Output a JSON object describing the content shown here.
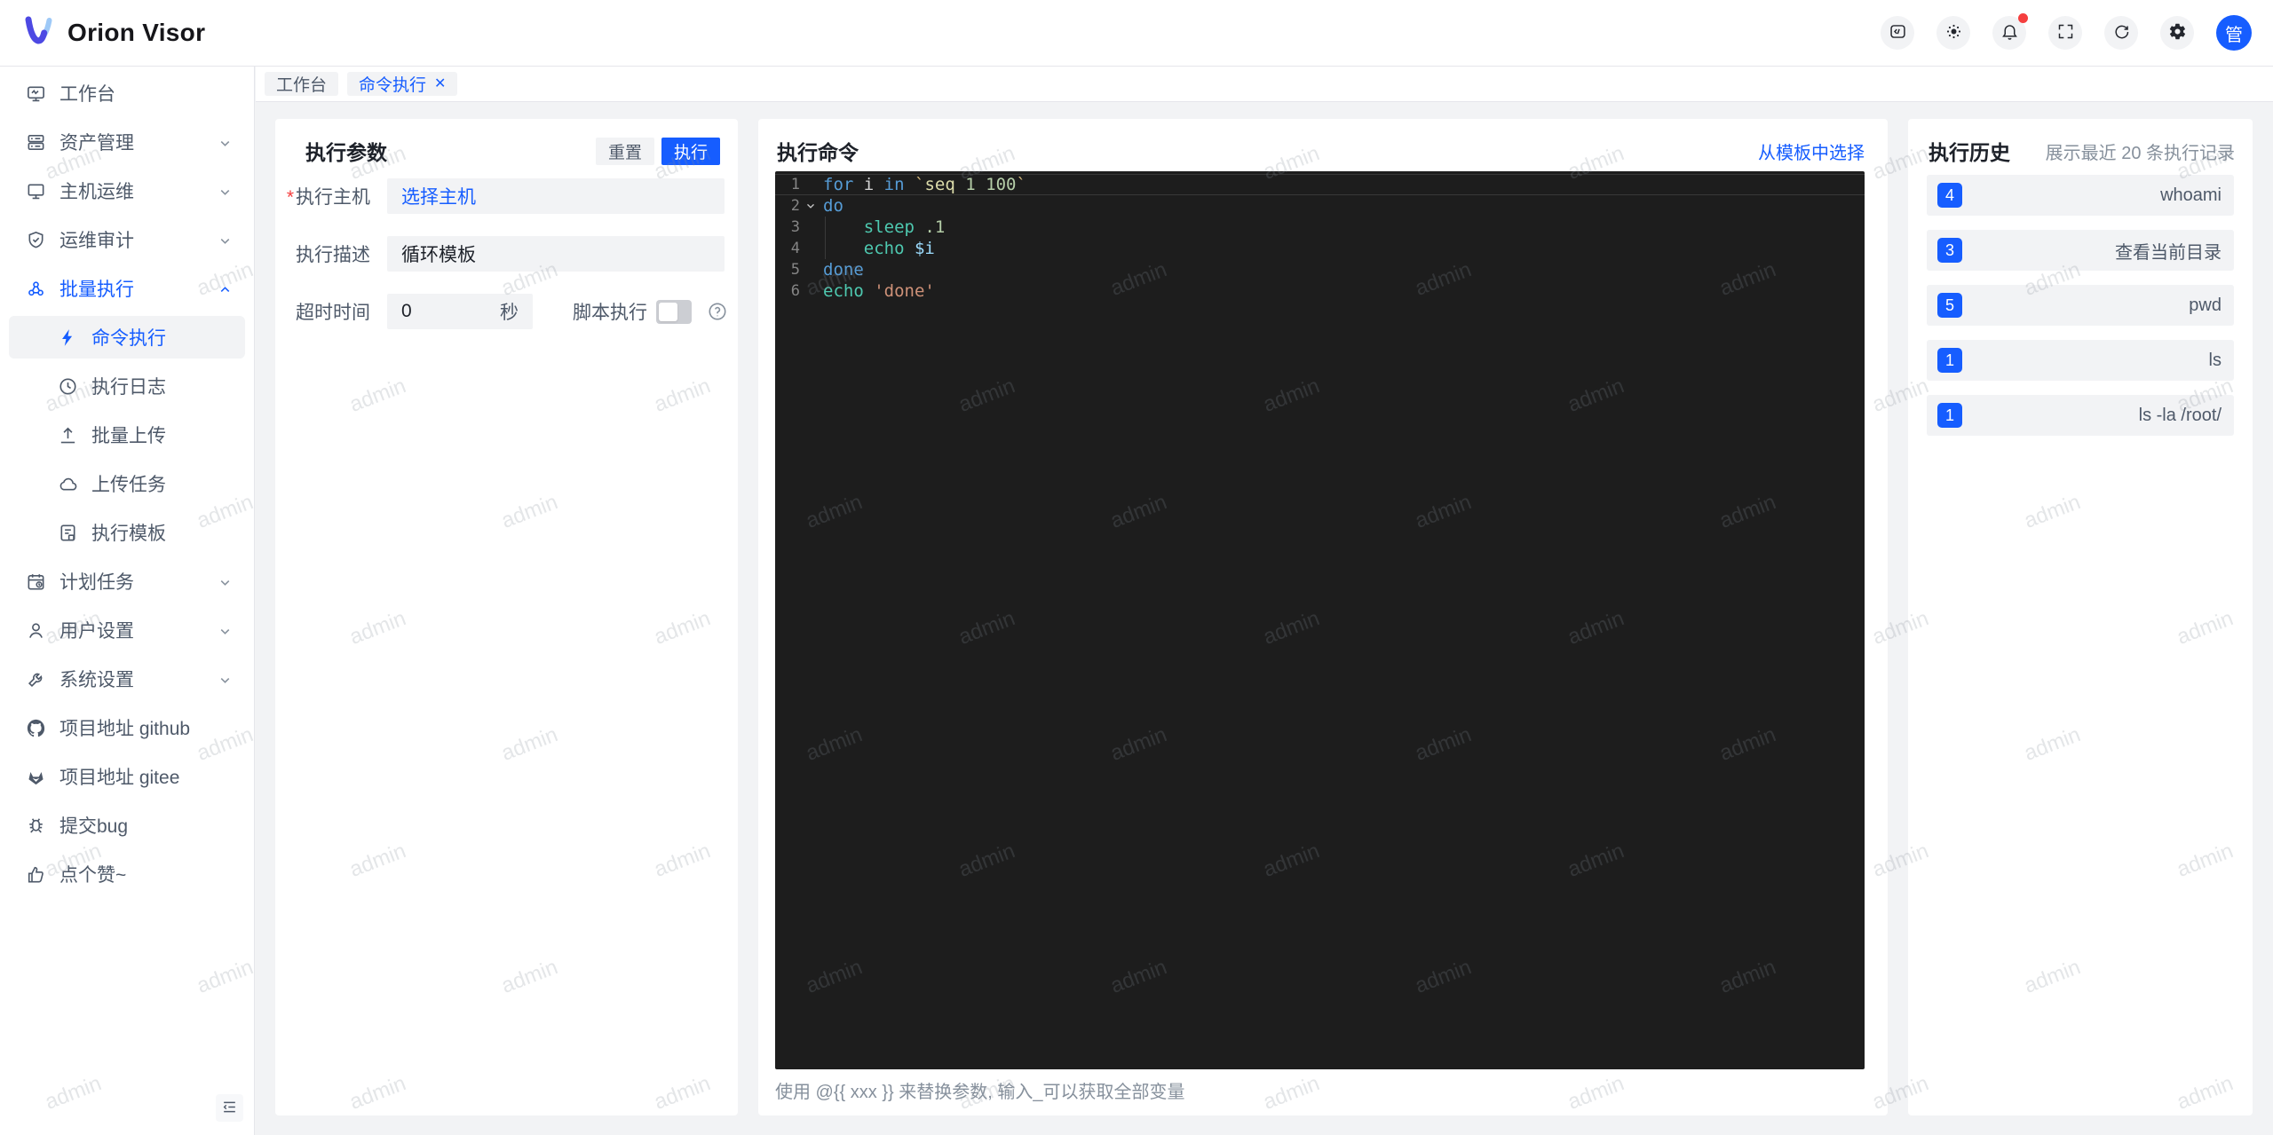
{
  "app": {
    "title": "Orion Visor"
  },
  "header": {
    "icons": [
      "code-settings-icon",
      "theme-icon",
      "notifications-icon",
      "fullscreen-icon",
      "refresh-icon",
      "gear-icon"
    ],
    "notification_badge": true,
    "avatar_text": "管"
  },
  "tabs": [
    {
      "id": "workbench",
      "label": "工作台",
      "active": false,
      "closable": false
    },
    {
      "id": "command-execution",
      "label": "命令执行",
      "active": true,
      "closable": true
    }
  ],
  "sidebar": {
    "items": [
      {
        "id": "workbench",
        "label": "工作台",
        "icon": "workbench-icon"
      },
      {
        "id": "asset-management",
        "label": "资产管理",
        "icon": "asset-icon",
        "chevron": "down"
      },
      {
        "id": "host-ops",
        "label": "主机运维",
        "icon": "host-icon",
        "chevron": "down"
      },
      {
        "id": "ops-audit",
        "label": "运维审计",
        "icon": "audit-icon",
        "chevron": "down"
      },
      {
        "id": "batch-execution",
        "label": "批量执行",
        "icon": "batch-icon",
        "chevron": "up",
        "active": true
      },
      {
        "id": "command-execution",
        "label": "命令执行",
        "icon": "lightning-icon",
        "child": true,
        "selected": true
      },
      {
        "id": "execution-log",
        "label": "执行日志",
        "icon": "history-icon",
        "child": true
      },
      {
        "id": "batch-upload",
        "label": "批量上传",
        "icon": "upload-icon",
        "child": true
      },
      {
        "id": "upload-tasks",
        "label": "上传任务",
        "icon": "cloud-icon",
        "child": true
      },
      {
        "id": "execution-template",
        "label": "执行模板",
        "icon": "template-icon",
        "child": true
      },
      {
        "id": "scheduled-tasks",
        "label": "计划任务",
        "icon": "schedule-icon",
        "chevron": "down"
      },
      {
        "id": "user-settings",
        "label": "用户设置",
        "icon": "user-icon",
        "chevron": "down"
      },
      {
        "id": "system-settings",
        "label": "系统设置",
        "icon": "wrench-icon",
        "chevron": "down"
      },
      {
        "id": "github",
        "label": "项目地址 github",
        "icon": "github-icon"
      },
      {
        "id": "gitee",
        "label": "项目地址 gitee",
        "icon": "gitee-icon"
      },
      {
        "id": "submit-bug",
        "label": "提交bug",
        "icon": "bug-icon"
      },
      {
        "id": "like",
        "label": "点个赞~",
        "icon": "thumbs-up-icon"
      }
    ]
  },
  "params_panel": {
    "title": "执行参数",
    "reset_label": "重置",
    "run_label": "执行",
    "fields": [
      {
        "label": "执行主机",
        "required": true,
        "value": "选择主机",
        "type": "link"
      },
      {
        "label": "执行描述",
        "required": false,
        "value": "循环模板",
        "type": "input"
      },
      {
        "label": "超时时间",
        "required": false,
        "value": "0",
        "suffix": "秒",
        "type": "input"
      }
    ],
    "script_exec_label": "脚本执行",
    "script_exec_on": false
  },
  "command_panel": {
    "title": "执行命令",
    "template_link": "从模板中选择",
    "hint": "使用 @{{ xxx }} 来替换参数, 输入_可以获取全部变量",
    "code_lines": [
      {
        "n": 1,
        "current": true,
        "tokens": [
          [
            "kw",
            "for"
          ],
          [
            "txt",
            " i "
          ],
          [
            "kw",
            "in"
          ],
          [
            "txt",
            " "
          ],
          [
            "tick",
            "`"
          ],
          [
            "fn",
            "seq"
          ],
          [
            "txt",
            " "
          ],
          [
            "num",
            "1"
          ],
          [
            "txt",
            " "
          ],
          [
            "num",
            "100"
          ],
          [
            "tick",
            "`"
          ]
        ]
      },
      {
        "n": 2,
        "fold": true,
        "tokens": [
          [
            "kw",
            "do"
          ]
        ]
      },
      {
        "n": 3,
        "guide": true,
        "tokens": [
          [
            "txt",
            "    "
          ],
          [
            "cmd",
            "sleep"
          ],
          [
            "txt",
            " "
          ],
          [
            "num",
            ".1"
          ]
        ]
      },
      {
        "n": 4,
        "guide": true,
        "tokens": [
          [
            "txt",
            "    "
          ],
          [
            "cmd",
            "echo"
          ],
          [
            "txt",
            " "
          ],
          [
            "var",
            "$i"
          ]
        ]
      },
      {
        "n": 5,
        "tokens": [
          [
            "kw",
            "done"
          ]
        ]
      },
      {
        "n": 6,
        "tokens": [
          [
            "cmd",
            "echo"
          ],
          [
            "txt",
            " "
          ],
          [
            "str",
            "'done'"
          ]
        ]
      }
    ]
  },
  "history_panel": {
    "title": "执行历史",
    "subtitle": "展示最近 20 条执行记录",
    "items": [
      {
        "count": "4",
        "command": "whoami"
      },
      {
        "count": "3",
        "command": "查看当前目录"
      },
      {
        "count": "5",
        "command": "pwd"
      },
      {
        "count": "1",
        "command": "ls"
      },
      {
        "count": "1",
        "command": "ls -la /root/"
      }
    ]
  },
  "watermark": {
    "text": "admin"
  },
  "colors": {
    "accent": "#165dff",
    "danger": "#f53f3f",
    "panel_bg": "#ffffff",
    "page_bg": "#f2f3f5",
    "field_bg": "#f2f3f5",
    "editor_bg": "#1d1d1d",
    "editor_keyword": "#569cd6",
    "editor_command": "#4ec9b0",
    "editor_number": "#b5cea8",
    "editor_string": "#ce9178",
    "editor_variable": "#9cdcfe",
    "text_secondary": "#4e5969",
    "text_muted": "#86909c"
  }
}
